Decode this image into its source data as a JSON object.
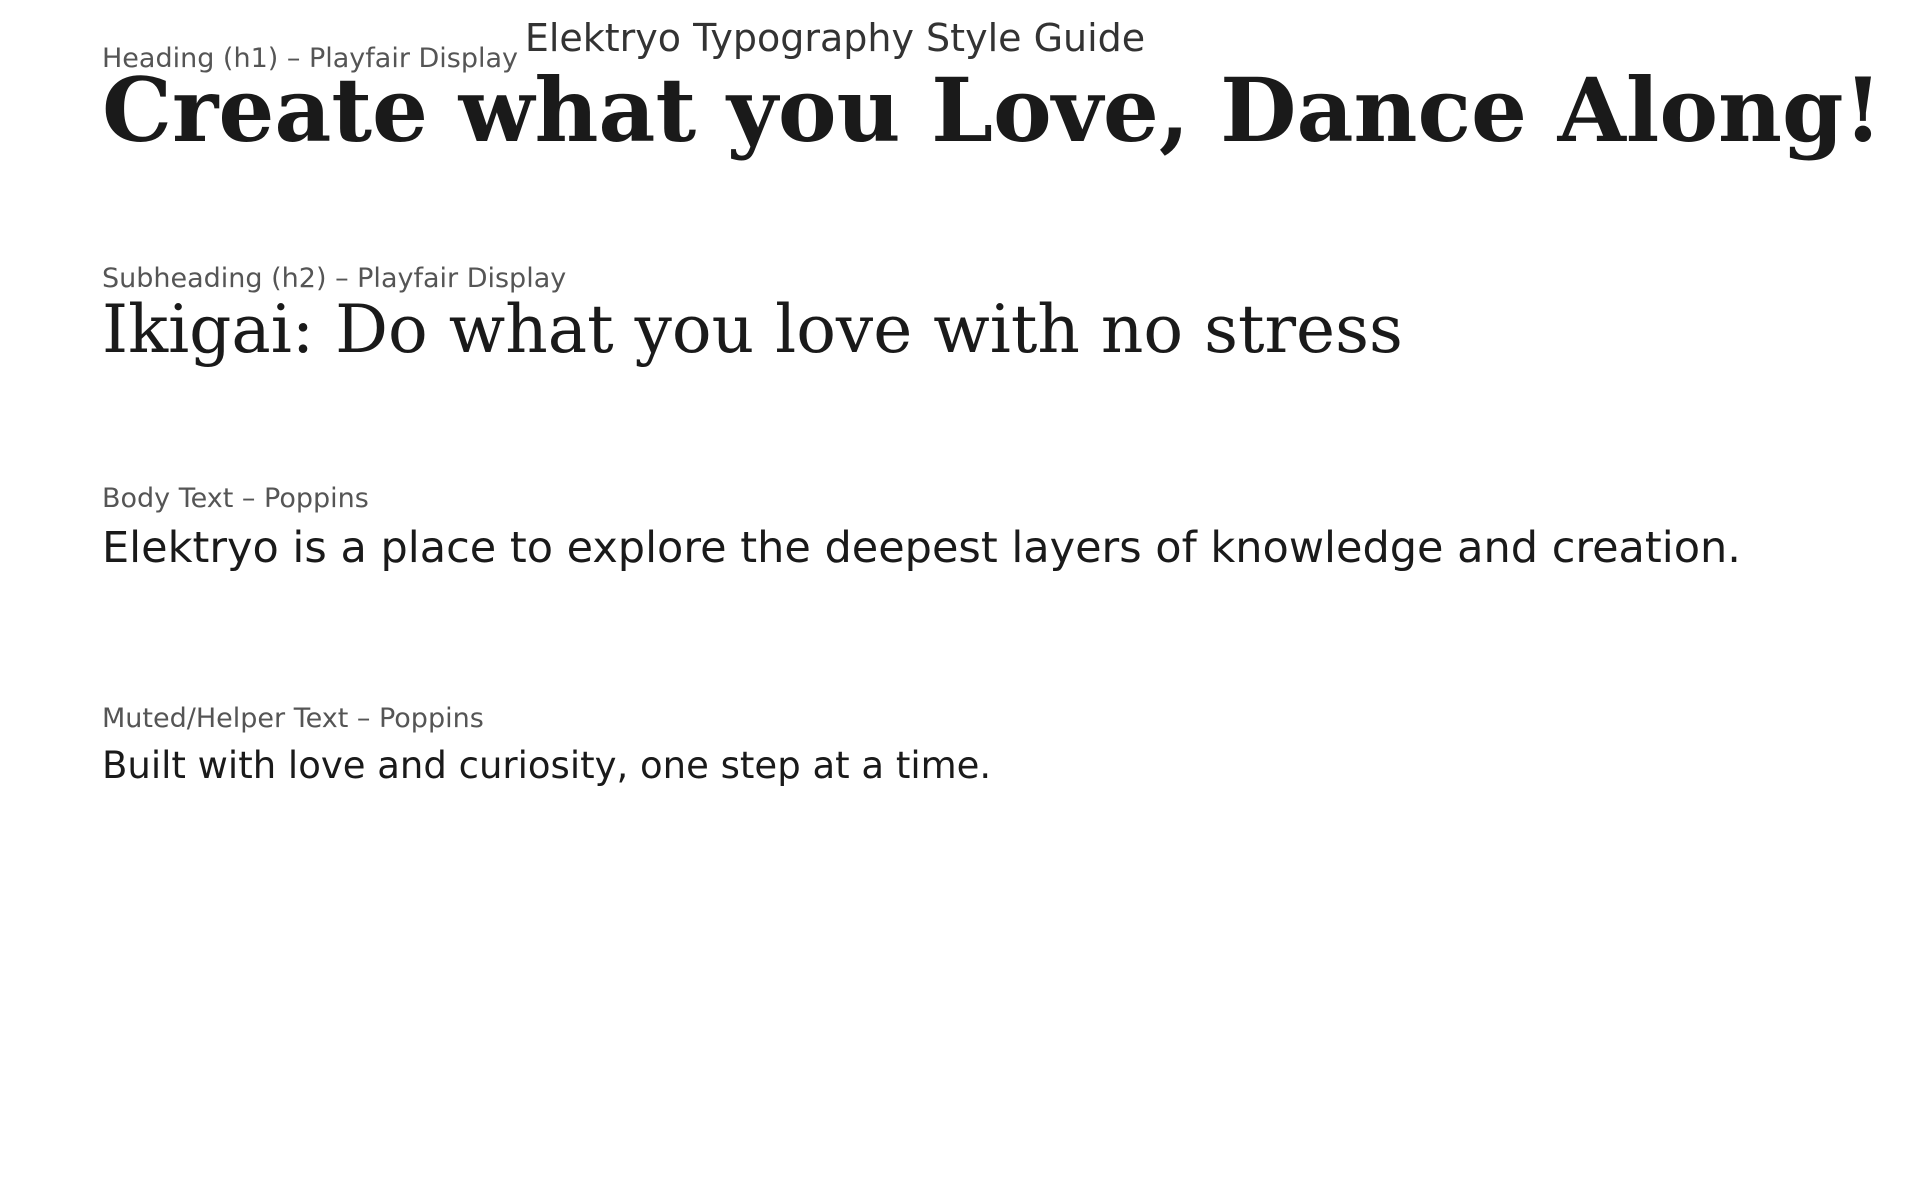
{
  "title": "Elektryo Typography Style Guide",
  "samples": [
    {
      "caption": "Heading (h1) – Playfair Display",
      "text": "Create what you Love, Dance Along!"
    },
    {
      "caption": "Subheading (h2) – Playfair Display",
      "text": "Ikigai: Do what you love with no stress"
    },
    {
      "caption": "Body Text – Poppins",
      "text": "Elektryo is a place to explore the deepest layers of knowledge and creation."
    },
    {
      "caption": "Muted/Helper Text – Poppins",
      "text": "Built with love and curiosity, one step at a time."
    }
  ],
  "colors": {
    "background": "#ffffff",
    "title": "#333333",
    "caption": "#555555",
    "sample": "#1a1a1a"
  }
}
